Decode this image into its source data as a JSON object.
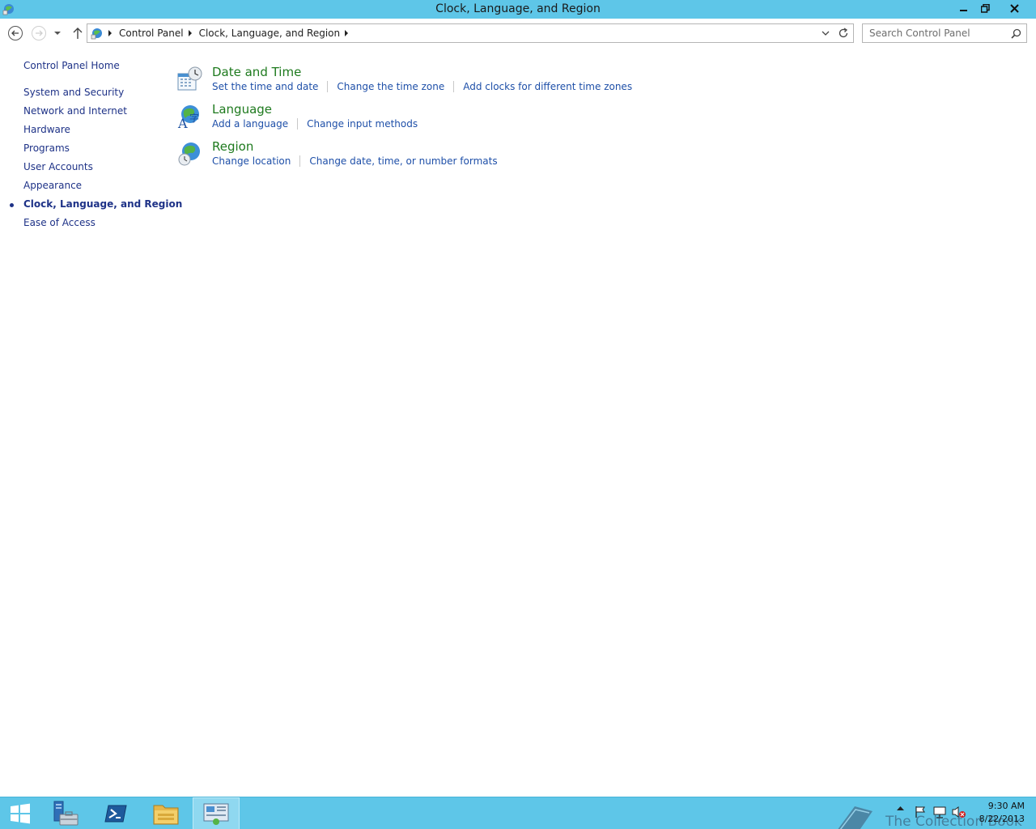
{
  "window": {
    "title": "Clock, Language, and Region",
    "controls": {
      "minimize": "minimize-icon",
      "restore": "restore-icon",
      "close": "close-icon"
    }
  },
  "navigation": {
    "breadcrumbs": [
      "Control Panel",
      "Clock, Language, and Region"
    ],
    "search_placeholder": "Search Control Panel"
  },
  "sidebar": {
    "home": "Control Panel Home",
    "items": [
      {
        "label": "System and Security",
        "current": false
      },
      {
        "label": "Network and Internet",
        "current": false
      },
      {
        "label": "Hardware",
        "current": false
      },
      {
        "label": "Programs",
        "current": false
      },
      {
        "label": "User Accounts",
        "current": false
      },
      {
        "label": "Appearance",
        "current": false
      },
      {
        "label": "Clock, Language, and Region",
        "current": true
      },
      {
        "label": "Ease of Access",
        "current": false
      }
    ]
  },
  "categories": [
    {
      "title": "Date and Time",
      "icon": "calendar-clock-icon",
      "links": [
        "Set the time and date",
        "Change the time zone",
        "Add clocks for different time zones"
      ]
    },
    {
      "title": "Language",
      "icon": "language-globe-icon",
      "links": [
        "Add a language",
        "Change input methods"
      ]
    },
    {
      "title": "Region",
      "icon": "region-globe-icon",
      "links": [
        "Change location",
        "Change date, time, or number formats"
      ]
    }
  ],
  "taskbar": {
    "apps": [
      "start-icon",
      "server-manager-icon",
      "powershell-icon",
      "file-explorer-icon",
      "control-panel-icon"
    ],
    "watermark": "The Collection Book",
    "clock": {
      "time": "9:30 AM",
      "date": "8/22/2013"
    }
  },
  "colors": {
    "title_bar": "#5ec6e8",
    "category_title": "#1e7a1e",
    "link": "#1e4fa8",
    "sidebar_link": "#1e3287"
  }
}
